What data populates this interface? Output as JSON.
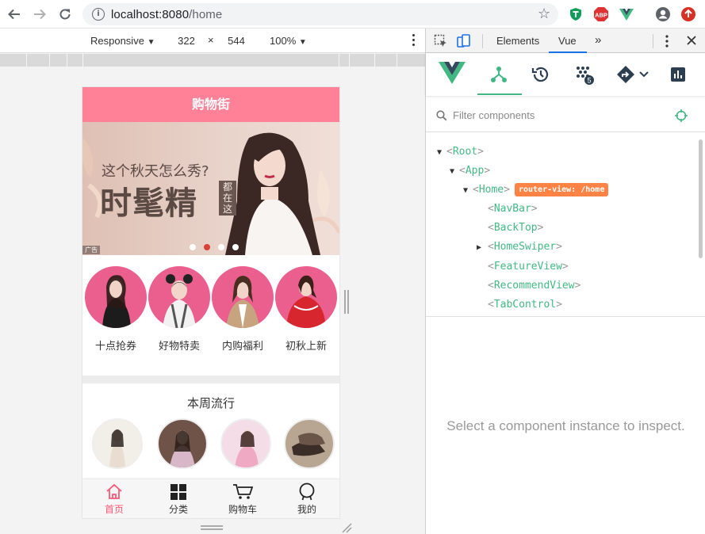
{
  "browser": {
    "url_host": "localhost:8080",
    "url_path": "/home",
    "ext_abp": "ABP"
  },
  "device_toolbar": {
    "device": "Responsive",
    "width": "322",
    "times": "×",
    "height": "544",
    "zoom": "100%"
  },
  "app": {
    "nav_title": "购物街",
    "banner": {
      "question": "这个秋天怎么秀?",
      "headline": "时髦精",
      "tag": "都在这",
      "ad_label": "广告",
      "dots_total": 4,
      "active_dot_index": 1
    },
    "features": [
      {
        "label": "十点抢券"
      },
      {
        "label": "好物特卖"
      },
      {
        "label": "内购福利"
      },
      {
        "label": "初秋上新"
      }
    ],
    "weekly_title": "本周流行",
    "tabs": [
      {
        "label": "首页",
        "icon": "home-icon",
        "active": true
      },
      {
        "label": "分类",
        "icon": "category-grid-icon",
        "active": false
      },
      {
        "label": "购物车",
        "icon": "cart-icon",
        "active": false
      },
      {
        "label": "我的",
        "icon": "profile-icon",
        "active": false
      }
    ],
    "accent_color": "#ff8198",
    "active_tab_color": "#ff5777"
  },
  "devtools": {
    "tabs": {
      "elements": "Elements",
      "vue": "Vue",
      "more": "»"
    },
    "filter_placeholder": "Filter components",
    "events_badge": "5",
    "tree": [
      {
        "name": "Root",
        "depth": 0,
        "expanded": true
      },
      {
        "name": "App",
        "depth": 1,
        "expanded": true
      },
      {
        "name": "Home",
        "depth": 2,
        "expanded": true,
        "badge": "router-view: /home"
      },
      {
        "name": "NavBar",
        "depth": 3
      },
      {
        "name": "BackTop",
        "depth": 3
      },
      {
        "name": "HomeSwiper",
        "depth": 3,
        "collapsed": true
      },
      {
        "name": "FeatureView",
        "depth": 3
      },
      {
        "name": "RecommendView",
        "depth": 3
      },
      {
        "name": "TabControl",
        "depth": 3
      }
    ],
    "inspect_message": "Select a component instance to inspect.",
    "vue_green": "#41b883"
  }
}
